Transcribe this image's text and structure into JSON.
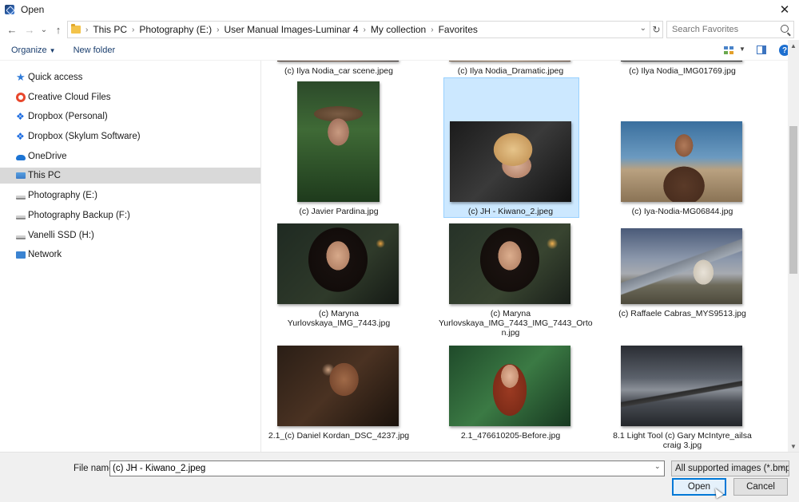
{
  "window": {
    "title": "Open",
    "close_glyph": "✕"
  },
  "nav": {
    "back_glyph": "←",
    "forward_glyph": "→",
    "recent_glyph": "⌄",
    "up_glyph": "↑",
    "breadcrumbs": [
      "This PC",
      "Photography (E:)",
      "User Manual Images-Luminar 4",
      "My collection",
      "Favorites"
    ],
    "separator": "›",
    "search_placeholder": "Search Favorites"
  },
  "toolbar": {
    "organize": "Organize",
    "new_folder": "New folder",
    "help": "?"
  },
  "sidebar": {
    "items": [
      {
        "label": "Quick access",
        "icon": "quick-access-star-icon"
      },
      {
        "label": "Creative Cloud Files",
        "icon": "creative-cloud-icon"
      },
      {
        "label": "Dropbox (Personal)",
        "icon": "dropbox-icon"
      },
      {
        "label": "Dropbox (Skylum Software)",
        "icon": "dropbox-icon"
      },
      {
        "label": "OneDrive",
        "icon": "onedrive-cloud-icon"
      },
      {
        "label": "This PC",
        "icon": "this-pc-icon",
        "selected": true
      },
      {
        "label": "Photography (E:)",
        "icon": "drive-icon"
      },
      {
        "label": "Photography Backup (F:)",
        "icon": "drive-icon"
      },
      {
        "label": "Vanelli SSD (H:)",
        "icon": "drive-icon"
      },
      {
        "label": "Network",
        "icon": "network-icon"
      }
    ]
  },
  "files": [
    {
      "name": "(c) Ilya Nodia_car scene.jpeg"
    },
    {
      "name": "(c) Ilya Nodia_Dramatic.jpeg"
    },
    {
      "name": "(c) Ilya Nodia_IMG01769.jpg"
    },
    {
      "name": "(c) Javier Pardina.jpg"
    },
    {
      "name": "(c) JH - Kiwano_2.jpeg",
      "selected": true
    },
    {
      "name": "(c) Iya-Nodia-MG06844.jpg"
    },
    {
      "name": "(c) Maryna Yurlovskaya_IMG_7443.jpg"
    },
    {
      "name": "(c) Maryna Yurlovskaya_IMG_7443_IMG_7443_Orton.jpg",
      "name_lines": [
        "(c) Maryna",
        "Yurlovskaya_IMG_7443_IMG_7443_Orto",
        "n.jpg"
      ]
    },
    {
      "name": "(c) Raffaele Cabras_MYS9513.jpg"
    },
    {
      "name": "2.1_(c) Daniel Kordan_DSC_4237.jpg"
    },
    {
      "name": "2.1_476610205-Before.jpg"
    },
    {
      "name": "8.1 Light Tool (c) Gary McIntyre_ailsacraig 3.jpg",
      "name_lines": [
        "8.1 Light Tool (c) Gary McIntyre_ailsa",
        "craig 3.jpg"
      ]
    }
  ],
  "footer": {
    "file_name_label": "File name:",
    "file_name_value": "(c) JH - Kiwano_2.jpeg",
    "file_type": "All supported images (*.bmp;*.c",
    "open_label": "Open",
    "cancel_label": "Cancel"
  }
}
